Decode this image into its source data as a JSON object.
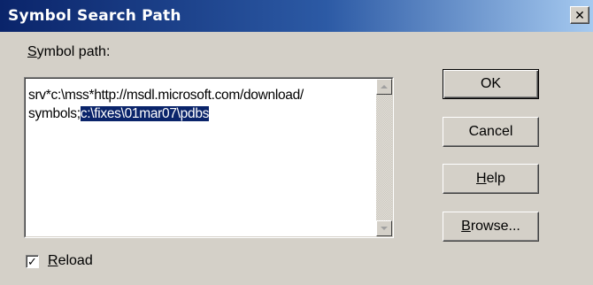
{
  "window": {
    "title": "Symbol Search Path",
    "close_glyph": "✕"
  },
  "symbol_path": {
    "label_accel": "S",
    "label_rest": "ymbol path:",
    "line1": "srv*c:\\mss*http://msdl.microsoft.com/download/",
    "line2_plain": "symbols;",
    "line2_selected": "c:\\fixes\\01mar07\\pdbs"
  },
  "buttons": {
    "ok": "OK",
    "cancel": "Cancel",
    "help_accel": "H",
    "help_rest": "elp",
    "browse_accel": "B",
    "browse_rest": "rowse..."
  },
  "reload": {
    "checked": true,
    "check_glyph": "✓",
    "label_accel": "R",
    "label_rest": "eload"
  },
  "colors": {
    "title_gradient_start": "#0a246a",
    "title_gradient_end": "#a6caf0",
    "face": "#d4d0c8",
    "selection": "#0a246a"
  }
}
